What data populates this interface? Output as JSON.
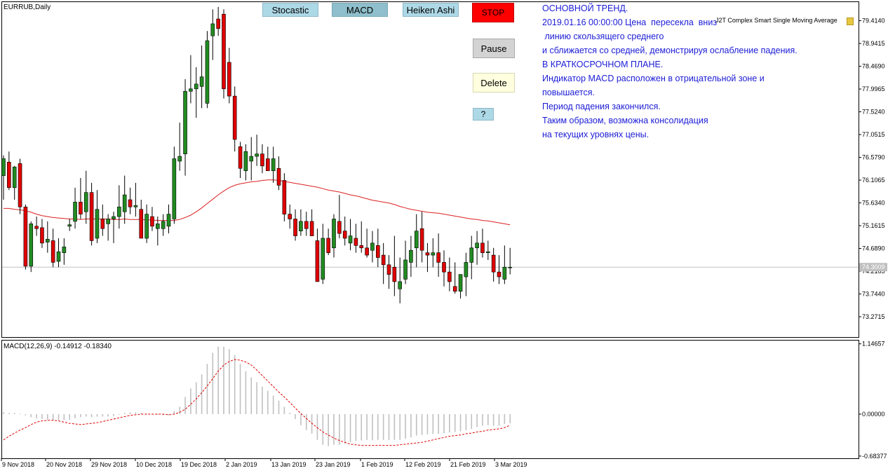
{
  "chart_title": "EURRUB,Daily",
  "indicator_name": "J2T Complex Smart Single Moving Average",
  "macd_label": "MACD(12,26,9) -0.14912 -0.18340",
  "current_price_label": "74.3009",
  "buttons": {
    "stocastic": "Stocastic",
    "macd": "MACD",
    "heiken": "Heiken Ashi",
    "stop": "STOP",
    "pause": "Pause",
    "delete": "Delete",
    "help": "?"
  },
  "comment_lines": [
    "ОСНОВНОЙ ТРЕНД.",
    "",
    "2019.01.16 00:00:00 Цена  пересекла  вниз",
    " линию скользящего среднего",
    "и сближается со средней, демонстрируя ослабление падения.",
    "В КРАТКОСРОЧНОМ ПЛАНЕ.",
    "Индикатор MACD расположен в отрицательной зоне и",
    "повышается.",
    "Период падения закончился.",
    "Таким образом, возможна консолидация",
    "на текущих уровнях цены."
  ],
  "colors": {
    "bull": "#228b22",
    "bear": "#e00000",
    "ma": "#dc2020",
    "signal": "#e00000",
    "histogram": "#c0c0c0",
    "text_blue": "#1c1cd6"
  },
  "chart_data": [
    {
      "type": "candlestick",
      "title": "EURRUB,Daily",
      "price_axis_ticks": [
        "79.4140",
        "78.9415",
        "78.4690",
        "77.9965",
        "77.5240",
        "77.0515",
        "76.5790",
        "76.1065",
        "75.6340",
        "75.1615",
        "74.6890",
        "74.2165",
        "73.7440",
        "73.2715"
      ],
      "ylim": [
        72.85,
        79.8
      ],
      "x_tick_labels": [
        "9 Nov 2018",
        "20 Nov 2018",
        "29 Nov 2018",
        "10 Dec 2018",
        "19 Dec 2018",
        "2 Jan 2019",
        "13 Jan 2019",
        "23 Jan 2019",
        "1 Feb 2019",
        "12 Feb 2019",
        "21 Feb 2019",
        "3 Mar 2019"
      ],
      "current_price": 74.3009,
      "candles": [
        {
          "o": 76.2,
          "h": 76.62,
          "l": 75.7,
          "c": 76.55
        },
        {
          "o": 76.48,
          "h": 76.7,
          "l": 75.9,
          "c": 75.95
        },
        {
          "o": 75.95,
          "h": 76.4,
          "l": 75.7,
          "c": 76.38
        },
        {
          "o": 76.45,
          "h": 76.55,
          "l": 75.4,
          "c": 75.55
        },
        {
          "o": 75.55,
          "h": 75.6,
          "l": 74.25,
          "c": 74.32
        },
        {
          "o": 74.32,
          "h": 75.25,
          "l": 74.2,
          "c": 75.2
        },
        {
          "o": 75.15,
          "h": 75.35,
          "l": 74.95,
          "c": 75.1
        },
        {
          "o": 75.12,
          "h": 75.3,
          "l": 74.7,
          "c": 74.8
        },
        {
          "o": 74.82,
          "h": 75.25,
          "l": 74.6,
          "c": 74.88
        },
        {
          "o": 74.85,
          "h": 75.1,
          "l": 74.3,
          "c": 74.4
        },
        {
          "o": 74.42,
          "h": 74.9,
          "l": 74.3,
          "c": 74.62
        },
        {
          "o": 74.6,
          "h": 74.9,
          "l": 74.35,
          "c": 74.72
        },
        {
          "o": 75.15,
          "h": 75.3,
          "l": 75.05,
          "c": 75.18
        },
        {
          "o": 75.25,
          "h": 75.95,
          "l": 75.1,
          "c": 75.65
        },
        {
          "o": 75.65,
          "h": 76.15,
          "l": 75.3,
          "c": 75.4
        },
        {
          "o": 75.45,
          "h": 76.3,
          "l": 75.2,
          "c": 75.85
        },
        {
          "o": 75.85,
          "h": 76.05,
          "l": 74.75,
          "c": 74.85
        },
        {
          "o": 74.9,
          "h": 75.9,
          "l": 74.8,
          "c": 75.5
        },
        {
          "o": 75.3,
          "h": 75.6,
          "l": 74.95,
          "c": 75.1
        },
        {
          "o": 75.2,
          "h": 75.4,
          "l": 74.85,
          "c": 75.3
        },
        {
          "o": 75.3,
          "h": 75.45,
          "l": 74.8,
          "c": 75.35
        },
        {
          "o": 75.35,
          "h": 76.0,
          "l": 75.1,
          "c": 75.55
        },
        {
          "o": 75.45,
          "h": 76.2,
          "l": 75.2,
          "c": 75.8
        },
        {
          "o": 75.7,
          "h": 75.95,
          "l": 75.4,
          "c": 75.55
        },
        {
          "o": 75.55,
          "h": 76.05,
          "l": 75.35,
          "c": 75.58
        },
        {
          "o": 75.5,
          "h": 75.7,
          "l": 74.9,
          "c": 74.9
        },
        {
          "o": 74.9,
          "h": 75.6,
          "l": 74.8,
          "c": 75.4
        },
        {
          "o": 75.35,
          "h": 75.55,
          "l": 75.05,
          "c": 75.15
        },
        {
          "o": 75.1,
          "h": 75.35,
          "l": 74.75,
          "c": 75.2
        },
        {
          "o": 75.1,
          "h": 75.4,
          "l": 74.95,
          "c": 75.25
        },
        {
          "o": 75.15,
          "h": 75.6,
          "l": 75.0,
          "c": 75.4
        },
        {
          "o": 75.3,
          "h": 76.8,
          "l": 75.2,
          "c": 76.55
        },
        {
          "o": 76.5,
          "h": 77.3,
          "l": 76.3,
          "c": 76.6
        },
        {
          "o": 76.65,
          "h": 78.2,
          "l": 76.2,
          "c": 77.95
        },
        {
          "o": 77.95,
          "h": 78.7,
          "l": 77.7,
          "c": 78.0
        },
        {
          "o": 78.0,
          "h": 78.45,
          "l": 77.4,
          "c": 78.1
        },
        {
          "o": 78.05,
          "h": 78.9,
          "l": 77.6,
          "c": 78.25
        },
        {
          "o": 77.7,
          "h": 79.2,
          "l": 77.6,
          "c": 79.0
        },
        {
          "o": 79.1,
          "h": 79.65,
          "l": 78.6,
          "c": 79.35
        },
        {
          "o": 79.45,
          "h": 79.7,
          "l": 79.1,
          "c": 79.25
        },
        {
          "o": 79.55,
          "h": 79.65,
          "l": 77.8,
          "c": 78.0
        },
        {
          "o": 78.55,
          "h": 78.85,
          "l": 77.7,
          "c": 77.85
        },
        {
          "o": 77.85,
          "h": 78.05,
          "l": 76.7,
          "c": 76.95
        },
        {
          "o": 76.8,
          "h": 76.9,
          "l": 76.15,
          "c": 76.35
        },
        {
          "o": 76.3,
          "h": 76.85,
          "l": 76.1,
          "c": 76.7
        },
        {
          "o": 76.5,
          "h": 77.0,
          "l": 76.1,
          "c": 76.6
        },
        {
          "o": 76.6,
          "h": 77.05,
          "l": 76.4,
          "c": 76.65
        },
        {
          "o": 76.65,
          "h": 76.85,
          "l": 76.25,
          "c": 76.4
        },
        {
          "o": 76.55,
          "h": 76.8,
          "l": 76.3,
          "c": 76.3
        },
        {
          "o": 76.3,
          "h": 76.8,
          "l": 76.05,
          "c": 76.55
        },
        {
          "o": 76.35,
          "h": 76.6,
          "l": 75.9,
          "c": 76.0
        },
        {
          "o": 76.1,
          "h": 76.25,
          "l": 75.25,
          "c": 75.4
        },
        {
          "o": 75.4,
          "h": 75.6,
          "l": 75.1,
          "c": 75.3
        },
        {
          "o": 75.3,
          "h": 75.5,
          "l": 74.85,
          "c": 74.95
        },
        {
          "o": 75.05,
          "h": 75.5,
          "l": 74.95,
          "c": 75.25
        },
        {
          "o": 75.25,
          "h": 75.45,
          "l": 74.95,
          "c": 75.1
        },
        {
          "o": 75.25,
          "h": 75.5,
          "l": 74.95,
          "c": 74.95
        },
        {
          "o": 74.85,
          "h": 75.1,
          "l": 74.0,
          "c": 74.0
        },
        {
          "o": 74.05,
          "h": 75.2,
          "l": 73.95,
          "c": 74.9
        },
        {
          "o": 74.9,
          "h": 75.1,
          "l": 74.55,
          "c": 74.6
        },
        {
          "o": 74.7,
          "h": 75.4,
          "l": 74.5,
          "c": 75.3
        },
        {
          "o": 75.25,
          "h": 75.8,
          "l": 74.9,
          "c": 75.0
        },
        {
          "o": 75.05,
          "h": 75.35,
          "l": 74.75,
          "c": 74.9
        },
        {
          "o": 74.8,
          "h": 75.3,
          "l": 74.65,
          "c": 74.95
        },
        {
          "o": 74.9,
          "h": 75.2,
          "l": 74.6,
          "c": 74.75
        },
        {
          "o": 74.75,
          "h": 75.25,
          "l": 74.6,
          "c": 74.7
        },
        {
          "o": 74.7,
          "h": 75.1,
          "l": 74.5,
          "c": 74.55
        },
        {
          "o": 74.65,
          "h": 75.05,
          "l": 74.4,
          "c": 74.8
        },
        {
          "o": 74.75,
          "h": 75.1,
          "l": 74.3,
          "c": 74.5
        },
        {
          "o": 74.55,
          "h": 74.8,
          "l": 73.95,
          "c": 74.35
        },
        {
          "o": 74.35,
          "h": 74.55,
          "l": 73.85,
          "c": 74.15
        },
        {
          "o": 74.3,
          "h": 74.95,
          "l": 73.7,
          "c": 74.0
        },
        {
          "o": 73.85,
          "h": 74.5,
          "l": 73.55,
          "c": 74.0
        },
        {
          "o": 74.05,
          "h": 74.85,
          "l": 73.95,
          "c": 74.45
        },
        {
          "o": 74.4,
          "h": 74.95,
          "l": 74.1,
          "c": 74.65
        },
        {
          "o": 74.7,
          "h": 75.4,
          "l": 74.3,
          "c": 75.05
        },
        {
          "o": 75.1,
          "h": 75.45,
          "l": 74.4,
          "c": 74.65
        },
        {
          "o": 74.6,
          "h": 74.8,
          "l": 74.2,
          "c": 74.55
        },
        {
          "o": 74.55,
          "h": 74.9,
          "l": 74.3,
          "c": 74.6
        },
        {
          "o": 74.6,
          "h": 75.0,
          "l": 74.1,
          "c": 74.4
        },
        {
          "o": 74.4,
          "h": 74.65,
          "l": 73.9,
          "c": 74.2
        },
        {
          "o": 74.2,
          "h": 74.5,
          "l": 73.8,
          "c": 74.0
        },
        {
          "o": 73.9,
          "h": 74.4,
          "l": 73.75,
          "c": 73.8
        },
        {
          "o": 73.8,
          "h": 74.0,
          "l": 73.65,
          "c": 74.15
        },
        {
          "o": 74.1,
          "h": 74.6,
          "l": 73.7,
          "c": 74.4
        },
        {
          "o": 74.4,
          "h": 74.95,
          "l": 74.05,
          "c": 74.7
        },
        {
          "o": 74.7,
          "h": 75.05,
          "l": 74.35,
          "c": 74.8
        },
        {
          "o": 74.8,
          "h": 75.1,
          "l": 74.5,
          "c": 74.6
        },
        {
          "o": 74.6,
          "h": 74.85,
          "l": 74.45,
          "c": 74.62
        },
        {
          "o": 74.55,
          "h": 74.7,
          "l": 74.0,
          "c": 74.2
        },
        {
          "o": 74.2,
          "h": 74.55,
          "l": 73.95,
          "c": 74.1
        },
        {
          "o": 74.05,
          "h": 74.75,
          "l": 73.95,
          "c": 74.3
        },
        {
          "o": 74.3,
          "h": 74.7,
          "l": 74.15,
          "c": 74.3
        }
      ],
      "moving_average": [
        75.52,
        75.52,
        75.5,
        75.49,
        75.47,
        75.44,
        75.4,
        75.37,
        75.35,
        75.33,
        75.32,
        75.31,
        75.3,
        75.3,
        75.29,
        75.3,
        75.3,
        75.3,
        75.3,
        75.3,
        75.29,
        75.29,
        75.3,
        75.29,
        75.29,
        75.29,
        75.28,
        75.28,
        75.27,
        75.27,
        75.27,
        75.27,
        75.29,
        75.33,
        75.38,
        75.45,
        75.53,
        75.62,
        75.71,
        75.8,
        75.88,
        75.95,
        76.0,
        76.03,
        76.05,
        76.07,
        76.08,
        76.1,
        76.11,
        76.11,
        76.1,
        76.08,
        76.06,
        76.04,
        76.02,
        76.0,
        75.98,
        75.96,
        75.93,
        75.9,
        75.88,
        75.86,
        75.83,
        75.8,
        75.78,
        75.75,
        75.72,
        75.69,
        75.67,
        75.65,
        75.63,
        75.6,
        75.56,
        75.53,
        75.5,
        75.48,
        75.46,
        75.44,
        75.43,
        75.42,
        75.4,
        75.38,
        75.36,
        75.34,
        75.32,
        75.3,
        75.29,
        75.27,
        75.26,
        75.24,
        75.22,
        75.2,
        75.18
      ]
    },
    {
      "type": "bar",
      "title": "MACD(12,26,9) -0.14912 -0.18340",
      "y_tick_labels": [
        "1.14657",
        "0.00000",
        "-0.68377"
      ],
      "ylim": [
        -0.72,
        1.2
      ],
      "histogram": [
        0.03,
        0.02,
        0.02,
        0.01,
        -0.02,
        -0.05,
        -0.07,
        -0.08,
        -0.09,
        -0.1,
        -0.1,
        -0.1,
        -0.09,
        -0.07,
        -0.05,
        -0.04,
        -0.05,
        -0.04,
        -0.04,
        -0.04,
        -0.03,
        -0.01,
        0.02,
        0.03,
        0.03,
        0.02,
        0.01,
        0.0,
        -0.01,
        -0.02,
        -0.02,
        0.05,
        0.12,
        0.28,
        0.42,
        0.52,
        0.65,
        0.82,
        1.0,
        1.1,
        1.1,
        1.06,
        0.96,
        0.82,
        0.7,
        0.6,
        0.52,
        0.45,
        0.38,
        0.3,
        0.22,
        0.12,
        0.02,
        -0.08,
        -0.18,
        -0.26,
        -0.32,
        -0.42,
        -0.5,
        -0.52,
        -0.5,
        -0.5,
        -0.48,
        -0.46,
        -0.44,
        -0.43,
        -0.42,
        -0.42,
        -0.42,
        -0.42,
        -0.42,
        -0.42,
        -0.42,
        -0.4,
        -0.38,
        -0.35,
        -0.34,
        -0.33,
        -0.32,
        -0.32,
        -0.31,
        -0.3,
        -0.29,
        -0.28,
        -0.26,
        -0.24,
        -0.21,
        -0.19,
        -0.18,
        -0.19,
        -0.19,
        -0.16,
        -0.15
      ],
      "signal": [
        -0.42,
        -0.36,
        -0.31,
        -0.26,
        -0.22,
        -0.17,
        -0.13,
        -0.11,
        -0.1,
        -0.1,
        -0.11,
        -0.13,
        -0.15,
        -0.16,
        -0.17,
        -0.16,
        -0.15,
        -0.14,
        -0.12,
        -0.1,
        -0.08,
        -0.06,
        -0.04,
        -0.02,
        -0.01,
        0.0,
        0.0,
        0.0,
        0.0,
        0.0,
        -0.01,
        0.0,
        0.03,
        0.08,
        0.16,
        0.25,
        0.35,
        0.46,
        0.58,
        0.7,
        0.8,
        0.86,
        0.89,
        0.88,
        0.85,
        0.8,
        0.72,
        0.63,
        0.54,
        0.45,
        0.36,
        0.28,
        0.19,
        0.1,
        0.01,
        -0.07,
        -0.15,
        -0.22,
        -0.29,
        -0.34,
        -0.39,
        -0.43,
        -0.46,
        -0.49,
        -0.5,
        -0.51,
        -0.51,
        -0.51,
        -0.51,
        -0.51,
        -0.51,
        -0.51,
        -0.5,
        -0.49,
        -0.48,
        -0.47,
        -0.46,
        -0.44,
        -0.42,
        -0.4,
        -0.38,
        -0.36,
        -0.35,
        -0.34,
        -0.32,
        -0.31,
        -0.29,
        -0.28,
        -0.26,
        -0.25,
        -0.24,
        -0.22,
        -0.18
      ]
    }
  ]
}
